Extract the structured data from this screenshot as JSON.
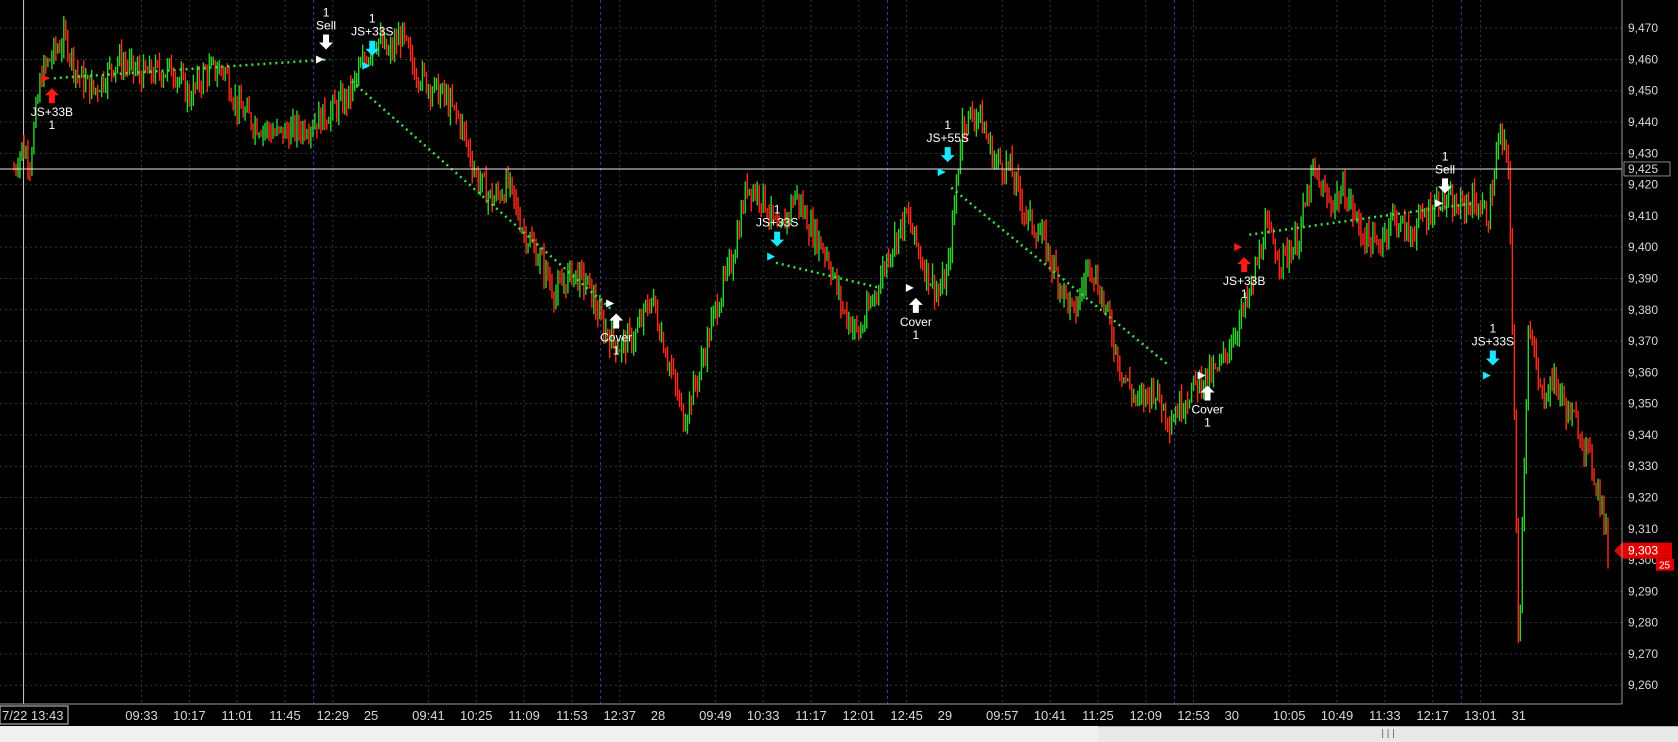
{
  "chart_data": {
    "type": "candlestick",
    "y_ticks": [
      9470,
      9460,
      9450,
      9440,
      9430,
      9420,
      9410,
      9400,
      9390,
      9380,
      9370,
      9360,
      9350,
      9340,
      9330,
      9320,
      9310,
      9300,
      9290,
      9280,
      9270,
      9260
    ],
    "ylim": [
      9254,
      9479
    ],
    "reference_line": {
      "value": 9425,
      "label": "9,425"
    },
    "last_price": {
      "value": 9303,
      "label": "9,303",
      "badge": "25"
    },
    "x_labels": [
      {
        "t": 0,
        "label": "7/22 13:43",
        "boxed": true
      },
      {
        "t": 8,
        "label": "09:33"
      },
      {
        "t": 11,
        "label": "10:17"
      },
      {
        "t": 14,
        "label": "11:01"
      },
      {
        "t": 17,
        "label": "11:45"
      },
      {
        "t": 20,
        "label": "12:29"
      },
      {
        "t": 22.4,
        "label": "25",
        "day": true
      },
      {
        "t": 26,
        "label": "09:41"
      },
      {
        "t": 29,
        "label": "10:25"
      },
      {
        "t": 32,
        "label": "11:09"
      },
      {
        "t": 35,
        "label": "11:53"
      },
      {
        "t": 38,
        "label": "12:37"
      },
      {
        "t": 40.4,
        "label": "28",
        "day": true
      },
      {
        "t": 44,
        "label": "09:49"
      },
      {
        "t": 47,
        "label": "10:33"
      },
      {
        "t": 50,
        "label": "11:17"
      },
      {
        "t": 53,
        "label": "12:01"
      },
      {
        "t": 56,
        "label": "12:45"
      },
      {
        "t": 58.4,
        "label": "29",
        "day": true
      },
      {
        "t": 62,
        "label": "09:57"
      },
      {
        "t": 65,
        "label": "10:41"
      },
      {
        "t": 68,
        "label": "11:25"
      },
      {
        "t": 71,
        "label": "12:09"
      },
      {
        "t": 74,
        "label": "12:53"
      },
      {
        "t": 76.4,
        "label": "30",
        "day": true
      },
      {
        "t": 80,
        "label": "10:05"
      },
      {
        "t": 83,
        "label": "10:49"
      },
      {
        "t": 86,
        "label": "11:33"
      },
      {
        "t": 89,
        "label": "12:17"
      },
      {
        "t": 92,
        "label": "13:01"
      },
      {
        "t": 94.4,
        "label": "31",
        "day": true
      }
    ],
    "day_separators_t": [
      0.6,
      18.8,
      36.8,
      54.8,
      72.8,
      90.8
    ],
    "price_path": [
      [
        0,
        9425
      ],
      [
        0.5,
        9432
      ],
      [
        1,
        9428
      ],
      [
        1.7,
        9455
      ],
      [
        2.5,
        9462
      ],
      [
        3.2,
        9467
      ],
      [
        4,
        9455
      ],
      [
        5,
        9450
      ],
      [
        6.5,
        9460
      ],
      [
        8,
        9455
      ],
      [
        10,
        9457
      ],
      [
        11,
        9448
      ],
      [
        12,
        9456
      ],
      [
        13.2,
        9457
      ],
      [
        14,
        9445
      ],
      [
        15,
        9440
      ],
      [
        16.5,
        9436
      ],
      [
        18,
        9438
      ],
      [
        19.5,
        9442
      ],
      [
        21,
        9448
      ],
      [
        22,
        9460
      ],
      [
        22.8,
        9467
      ],
      [
        23.5,
        9461
      ],
      [
        24.3,
        9468
      ],
      [
        25,
        9458
      ],
      [
        26,
        9452
      ],
      [
        27,
        9448
      ],
      [
        28,
        9440
      ],
      [
        29,
        9423
      ],
      [
        30,
        9415
      ],
      [
        31,
        9420
      ],
      [
        32,
        9405
      ],
      [
        33,
        9396
      ],
      [
        34,
        9385
      ],
      [
        35,
        9392
      ],
      [
        36,
        9388
      ],
      [
        37,
        9374
      ],
      [
        38,
        9368
      ],
      [
        39,
        9372
      ],
      [
        40,
        9384
      ],
      [
        41,
        9365
      ],
      [
        42,
        9345
      ],
      [
        43,
        9360
      ],
      [
        44,
        9380
      ],
      [
        45,
        9395
      ],
      [
        46,
        9420
      ],
      [
        47,
        9416
      ],
      [
        48,
        9403
      ],
      [
        49,
        9417
      ],
      [
        50,
        9406
      ],
      [
        51,
        9398
      ],
      [
        52,
        9380
      ],
      [
        53,
        9372
      ],
      [
        54,
        9385
      ],
      [
        55,
        9400
      ],
      [
        56,
        9410
      ],
      [
        57,
        9395
      ],
      [
        58,
        9385
      ],
      [
        58.6,
        9392
      ],
      [
        59.5,
        9440
      ],
      [
        60.5,
        9443
      ],
      [
        61.5,
        9428
      ],
      [
        62.5,
        9425
      ],
      [
        63.5,
        9410
      ],
      [
        64.5,
        9403
      ],
      [
        65.5,
        9390
      ],
      [
        66.5,
        9378
      ],
      [
        67.5,
        9396
      ],
      [
        68.5,
        9380
      ],
      [
        69.5,
        9360
      ],
      [
        70.5,
        9350
      ],
      [
        71.5,
        9355
      ],
      [
        72.5,
        9345
      ],
      [
        73.5,
        9352
      ],
      [
        74.5,
        9358
      ],
      [
        75.5,
        9360
      ],
      [
        76.5,
        9372
      ],
      [
        77.5,
        9384
      ],
      [
        78.5,
        9406
      ],
      [
        79.5,
        9396
      ],
      [
        80.5,
        9402
      ],
      [
        81.5,
        9424
      ],
      [
        82.5,
        9414
      ],
      [
        83.5,
        9418
      ],
      [
        84.5,
        9405
      ],
      [
        85.5,
        9400
      ],
      [
        86.5,
        9410
      ],
      [
        87.5,
        9404
      ],
      [
        88.5,
        9410
      ],
      [
        89.5,
        9416
      ],
      [
        90.5,
        9412
      ],
      [
        91.5,
        9415
      ],
      [
        92.5,
        9410
      ],
      [
        93.2,
        9436
      ],
      [
        93.8,
        9425
      ],
      [
        94.4,
        9272
      ],
      [
        95,
        9375
      ],
      [
        95.8,
        9352
      ],
      [
        96.6,
        9358
      ],
      [
        97.4,
        9348
      ],
      [
        98.2,
        9342
      ],
      [
        99,
        9330
      ],
      [
        99.6,
        9318
      ],
      [
        100,
        9303
      ]
    ],
    "trades": [
      {
        "t_in": 2.5,
        "p_in": 9454,
        "t_out": 19.8,
        "p_out": 9460,
        "dashed": true
      },
      {
        "t_in": 21.2,
        "p_in": 9453,
        "t_out": 37.5,
        "p_out": 9380,
        "dashed": true
      },
      {
        "t_in": 47.8,
        "p_in": 9395,
        "t_out": 54.3,
        "p_out": 9387,
        "dashed": true
      },
      {
        "t_in": 58.8,
        "p_in": 9419,
        "t_out": 72.5,
        "p_out": 9362,
        "dashed": true
      },
      {
        "t_in": 77.5,
        "p_in": 9404,
        "t_out": 91.5,
        "p_out": 9414,
        "dashed": true
      }
    ],
    "signals": [
      {
        "t": 2.0,
        "p": 9454,
        "label": "JS+33B",
        "qty": "1",
        "arrow": "up",
        "color": "#ff1a1a",
        "text_pos": "below"
      },
      {
        "t": 19.2,
        "p": 9460,
        "label": "Sell",
        "qty": "1",
        "arrow": "down",
        "color": "#ffffff",
        "text_pos": "above"
      },
      {
        "t": 22.1,
        "p": 9458,
        "label": "JS+33S",
        "qty": "1",
        "arrow": "down",
        "color": "#19e6ff",
        "text_pos": "above"
      },
      {
        "t": 37.4,
        "p": 9382,
        "label": "Cover",
        "qty": "1",
        "arrow": "up",
        "color": "#ffffff",
        "text_pos": "below"
      },
      {
        "t": 47.5,
        "p": 9397,
        "label": "JS+33S",
        "qty": "1",
        "arrow": "down",
        "color": "#19e6ff",
        "text_pos": "above"
      },
      {
        "t": 56.2,
        "p": 9387,
        "label": "Cover",
        "qty": "1",
        "arrow": "up",
        "color": "#ffffff",
        "text_pos": "below"
      },
      {
        "t": 58.2,
        "p": 9424,
        "label": "JS+55S",
        "qty": "1",
        "arrow": "down",
        "color": "#19e6ff",
        "text_pos": "above"
      },
      {
        "t": 74.5,
        "p": 9359,
        "label": "Cover",
        "qty": "1",
        "arrow": "up",
        "color": "#ffffff",
        "text_pos": "below"
      },
      {
        "t": 76.8,
        "p": 9400,
        "label": "JS+33B",
        "qty": "1",
        "arrow": "up",
        "color": "#ff1a1a",
        "text_pos": "below"
      },
      {
        "t": 89.4,
        "p": 9414,
        "label": "Sell",
        "qty": "1",
        "arrow": "down",
        "color": "#ffffff",
        "text_pos": "above"
      },
      {
        "t": 92.4,
        "p": 9359,
        "label": "JS+33S",
        "qty": "1",
        "arrow": "down",
        "color": "#19e6ff",
        "text_pos": "above"
      }
    ],
    "colors": {
      "background": "#000000",
      "grid": "#2e3a2e",
      "day_separator": "#3a3aa8",
      "up_bar": "#2ed12e",
      "down_bar": "#ff2a1a",
      "trade_line": "#3fe04a",
      "reference_line": "#e8e8e8",
      "last_price_badge": "#e00000"
    }
  }
}
